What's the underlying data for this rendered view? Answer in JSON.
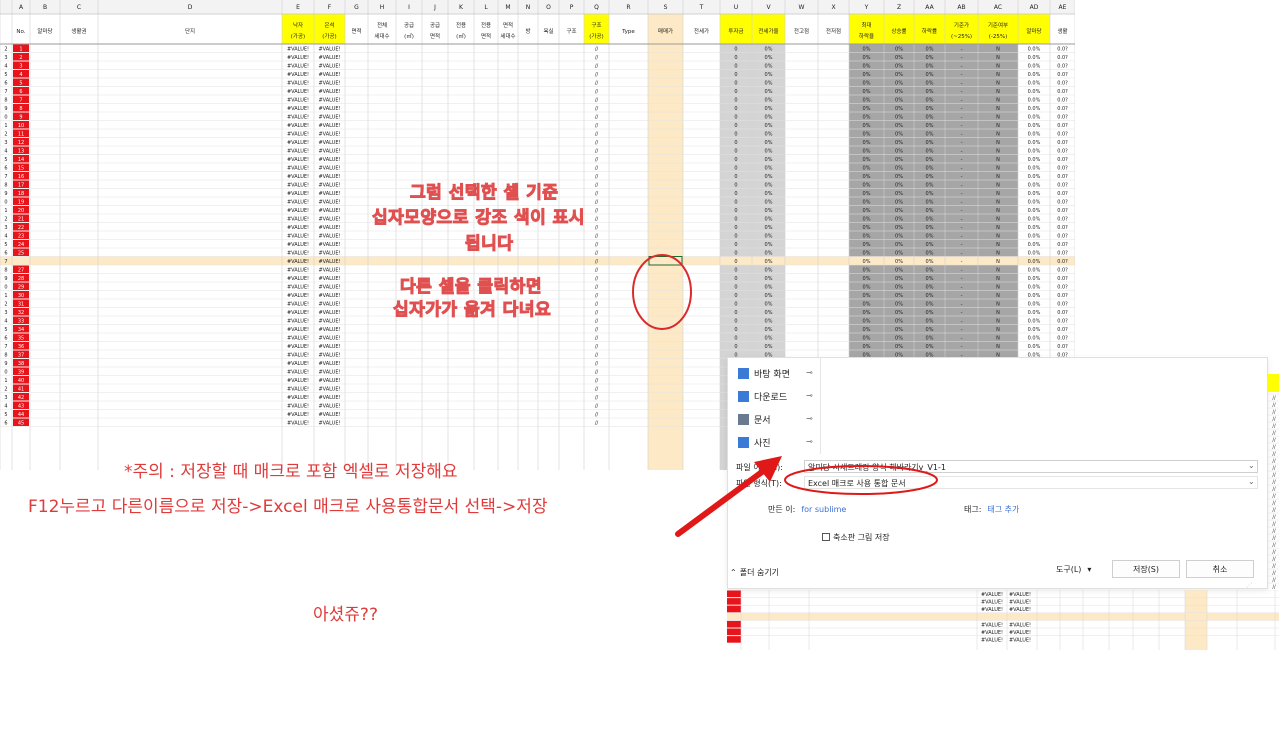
{
  "sheet": {
    "col_letters": [
      "A",
      "B",
      "C",
      "D",
      "E",
      "F",
      "G",
      "H",
      "I",
      "J",
      "K",
      "L",
      "M",
      "N",
      "O",
      "P",
      "Q",
      "R",
      "S",
      "T",
      "U",
      "V",
      "W",
      "X",
      "Y",
      "Z",
      "AA",
      "AB",
      "AC",
      "AD",
      "AE"
    ],
    "headers": [
      "No.",
      "알마당",
      "생활권",
      "단지",
      "낙자\n(가공)",
      "은석\n(가공)",
      "면적",
      "전체\n세대수",
      "공급\n(㎡)",
      "공급\n면적",
      "전용\n(㎡)",
      "전용\n면적",
      "면적\n세대수",
      "방",
      "욕실",
      "구조",
      "구조\n(가공)",
      "Type",
      "매매가",
      "전세가",
      "투자금",
      "전세가율",
      "전고점",
      "전저점",
      "최대\n하락율",
      "상승률",
      "하락률",
      "기준가\n(~25%)",
      "기준여부\n(-25%)",
      "알마당",
      "생활"
    ],
    "value_error": "#VALUE!",
    "slash": "//",
    "zero": "0",
    "zero_pct": "0%",
    "dash": "-",
    "flag_n": "N",
    "ad_val": "0.0%",
    "ae_val": "0.0?",
    "row_numbers": [
      "1",
      "2",
      "3",
      "4",
      "5",
      "6",
      "7",
      "8",
      "9",
      "10",
      "11",
      "12",
      "13",
      "14",
      "15",
      "16",
      "17",
      "18",
      "19",
      "20",
      "21",
      "22",
      "23",
      "24",
      "25",
      "",
      "27",
      "28",
      "29",
      "30",
      "31",
      "32",
      "33",
      "34",
      "35",
      "36",
      "37",
      "38",
      "39",
      "40",
      "41",
      "42",
      "43",
      "44",
      "45"
    ],
    "left_row_labels": [
      "2",
      "3",
      "4",
      "5",
      "6",
      "7",
      "8",
      "9",
      "0",
      "1",
      "2",
      "3",
      "4",
      "5",
      "6",
      "7",
      "8",
      "9",
      "0",
      "1",
      "2",
      "3",
      "4",
      "5",
      "6",
      "7",
      "8",
      "9",
      "0",
      "1",
      "2",
      "3",
      "4",
      "5",
      "6",
      "7",
      "8",
      "9",
      "0",
      "1",
      "2",
      "3",
      "4",
      "5",
      "6"
    ]
  },
  "annotations": {
    "center_line1": "그럼 선택한 셀 기준",
    "center_line2": "십자모양으로 강조 색이 표시",
    "center_line3": "됩니다",
    "click_line1": "다른 셀을 클릭하면",
    "click_line2": "십자가가 옮겨 다녀요",
    "warning": "*주의 : 저장할 때 매크로 포함 엑셀로  저장해요",
    "instruction": "F12누르고 다른이름으로 저장->Excel 매크로 사용통합문서 선택->저장",
    "closing": "아셨쥬??"
  },
  "dialog": {
    "nav_items": [
      {
        "label": "바탕 화면",
        "icon": "desktop-icon"
      },
      {
        "label": "다운로드",
        "icon": "download-icon"
      },
      {
        "label": "문서",
        "icon": "document-icon"
      },
      {
        "label": "사진",
        "icon": "pictures-icon"
      }
    ],
    "pin_glyph": "📌",
    "filename_label": "파일 이름(N):",
    "filename_value": "알미당 시세트래킹 양식 해바라기v_V1-1",
    "filetype_label": "파일 형식(T):",
    "filetype_value": "Excel 매크로 사용 통합 문서",
    "author_label": "만든 이:",
    "author_value": "for sublime",
    "tags_label": "태그:",
    "tags_value": "태그 추가",
    "thumbnail_label": "축소판 그림 저장",
    "hide_folders": "폴더 숨기기",
    "tools_label": "도구(L)",
    "save_label": "저장(S)",
    "cancel_label": "취소"
  },
  "colors": {
    "red_no": "#e8141b",
    "yellow_header": "#ffff00",
    "highlight": "#fde9c5",
    "gray_band": "#a6a6a6",
    "annotation_red": "#e03a3a",
    "circle_red": "#d92b2b"
  }
}
